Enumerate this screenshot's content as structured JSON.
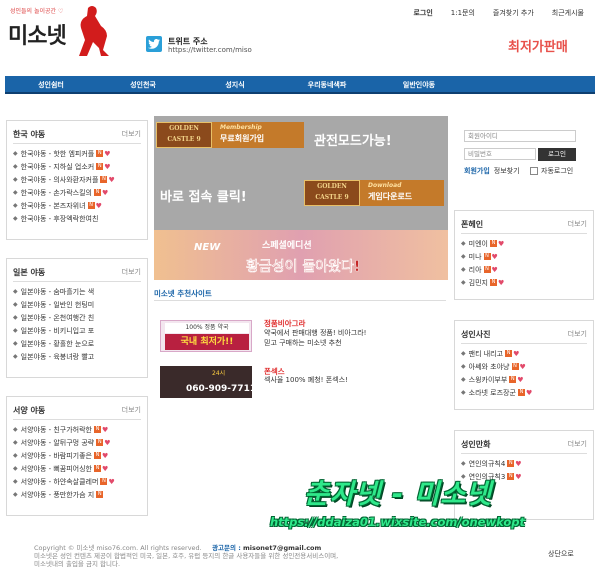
{
  "header": {
    "logo_tagline": "성인들의 놀이공간 ♡",
    "logo_name": "미소넷",
    "twitter_label": "트위트 주소",
    "twitter_url": "https://twitter.com/miso",
    "top_links": [
      "로그인",
      "1:1문의",
      "즐겨찾기 추가",
      "최근게시물"
    ],
    "promo_text": "최저가판매"
  },
  "main_nav": [
    "성인쉼터",
    "성인천국",
    "성지식",
    "우리동네색파",
    "일반인야동"
  ],
  "left_boxes": [
    {
      "title": "한국 야동",
      "more": "더보기",
      "items": [
        "한국야동 - 핫한 엠피커플",
        "한국야동 - 지하실 업소커",
        "한국야동 - 의사와환자커플",
        "한국야동 - 손가락스킬의",
        "한국야동 - 본즈자위녀",
        "한국야동 - 후장엑락한여친"
      ]
    },
    {
      "title": "일본 야동",
      "more": "더보기",
      "items": [
        "일본야동 - 숨마흘기는 색",
        "일본야동 - 일반인 헌팅미",
        "일본야동 - 온천여행간 친",
        "일본야동 - 비키니입고 포",
        "일본야동 - 황홀한 눈으로",
        "일본야동 - 육봉녀랑 빨고"
      ]
    },
    {
      "title": "서양 야동",
      "more": "더보기",
      "items": [
        "서양야동 - 친구가허락한",
        "서양야동 - 알뒤구멍 공략",
        "서양야동 - 바람피기좋은",
        "서양야동 - 뻐꿈피어싱한",
        "서양야동 - 하얀속살클레머",
        "서양야동 - 풍만한가슴 지"
      ]
    }
  ],
  "center": {
    "banner_logo": "GOLDEN CASTLE 9",
    "membership_label": "Membership",
    "membership_text": "무료회원가입",
    "fullscreen_text": "관전모드가능!",
    "click_text": "바로 접속 클릭!",
    "download_label": "Download",
    "download_text": "게임다운로드",
    "new_label": "NEW",
    "new_line1": "스페셜에디션",
    "new_line2": "황금성이 돌아왔다!",
    "rec_title": "미소넷 추천사이트",
    "recs": [
      {
        "img_top": "100% 정품 약국",
        "img_main": "국내 최저가!!",
        "title": "정품비아그라",
        "desc1": "약국에서 판매대행 정품! 비아그라!",
        "desc2": "믿고 구매하는 미소넷 추천"
      },
      {
        "img_top": "24시",
        "img_main": "060-909-7711",
        "title": "폰섹스",
        "desc1": "섹사율 100% 폐청! 폰섹스!",
        "desc2": ""
      }
    ]
  },
  "login": {
    "id_placeholder": "회원아이디",
    "pw_placeholder": "비밀번호",
    "button": "로그인",
    "join": "회원가입",
    "find": "정보찾기",
    "auto": "자동로그인"
  },
  "right_boxes": [
    {
      "title": "폰헤인",
      "more": "더보기",
      "items": [
        "미엔이",
        "미나",
        "리아",
        "김민지"
      ]
    },
    {
      "title": "성인사진",
      "more": "더보기",
      "items": [
        "팬티 내리고",
        "아쎄와 초야냥",
        "스윙카이부부",
        "소라넷 로즈장군"
      ]
    },
    {
      "title": "성인만화",
      "more": "더보기",
      "items": [
        "연인의규칙4",
        "연인의규칙3",
        "",
        ""
      ]
    }
  ],
  "footer": {
    "copyright": "Copyright © 미소넷 miso76.com. All rights reserved.",
    "ad_label": "광고문의 :",
    "ad_email": "misonet7@gmail.com",
    "line2": "미소넷은 성인 컨텐츠 제공이 합법적인 미국, 일본, 호주, 유럽 등지의 한글 사용자들을 위한 성인전용서비스이며,",
    "line3": "미소넷내의 출입을 금지 합니다.",
    "to_top": "상단으로"
  },
  "watermark": {
    "line1": "춘자넷 - 미소넷",
    "line2": "https://ddaiza01.wixsite.com/onewkopt"
  },
  "colors": {
    "nav_blue": "#1a64a8",
    "promo_red": "#e8504a",
    "badge_orange": "#e8652a",
    "watermark_green": "#2fe88a"
  }
}
